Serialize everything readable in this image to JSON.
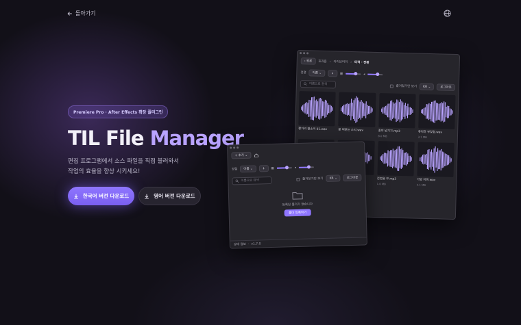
{
  "nav": {
    "back_label": "돌아가기",
    "back_icon": "arrow-left-icon",
    "lang_icon": "globe-icon"
  },
  "hero": {
    "badge": "Premiere Pro · After Effects 확장 플러그인",
    "title_part1": "TIL File ",
    "title_part2": "Manager",
    "desc_line1": "편집 프로그램에서 소스 파일을 직접 불러와서",
    "desc_line2": "작업의 효율을 향상 시키세요!",
    "primary_button": "한국어 버전 다운로드",
    "secondary_button": "영어 버전 다운로드"
  },
  "colors": {
    "accent": "#8f76ff",
    "accent_light": "#b9a3ff",
    "background": "#121018",
    "window": "#26252b"
  },
  "app_back": {
    "root_button": "원본",
    "breadcrumb": [
      "효과음",
      "라이브러리",
      "타격 · 전환"
    ],
    "sort_label": "정렬",
    "sort_value": "이름",
    "search_placeholder": "이름으로 검색",
    "favorites_label": "즐겨찾기만 보기",
    "lang_value": "KR",
    "logout_label": "로그아웃",
    "files": [
      {
        "name": "펑거리 철소리 01.wav",
        "size": ""
      },
      {
        "name": "문 여닫는 소리.wav",
        "size": ""
      },
      {
        "name": "종이 넘기기.mp3",
        "size": "8.0 MB"
      },
      {
        "name": "유리잔 부딪힘.wav",
        "size": "3.1 MB"
      },
      {
        "name": "",
        "size": ""
      },
      {
        "name": "",
        "size": ""
      },
      {
        "name": "전전음 꾸.mp3",
        "size": "1.6 MB"
      },
      {
        "name": "가방 지퍼.wav",
        "size": "4.1 MB"
      }
    ]
  },
  "app_front": {
    "add_button": "+ 추가",
    "home_icon": "home-icon",
    "sort_label": "정렬",
    "sort_value": "이름",
    "search_placeholder": "이름으로 검색",
    "favorites_label": "즐겨찾기만 보기",
    "lang_value": "KR",
    "logout_label": "로그아웃",
    "empty_text": "등록된 폴더가 없습니다",
    "register_button": "폴더 등록하기",
    "status_text": "상태 정보",
    "version": "v1.7.0"
  }
}
